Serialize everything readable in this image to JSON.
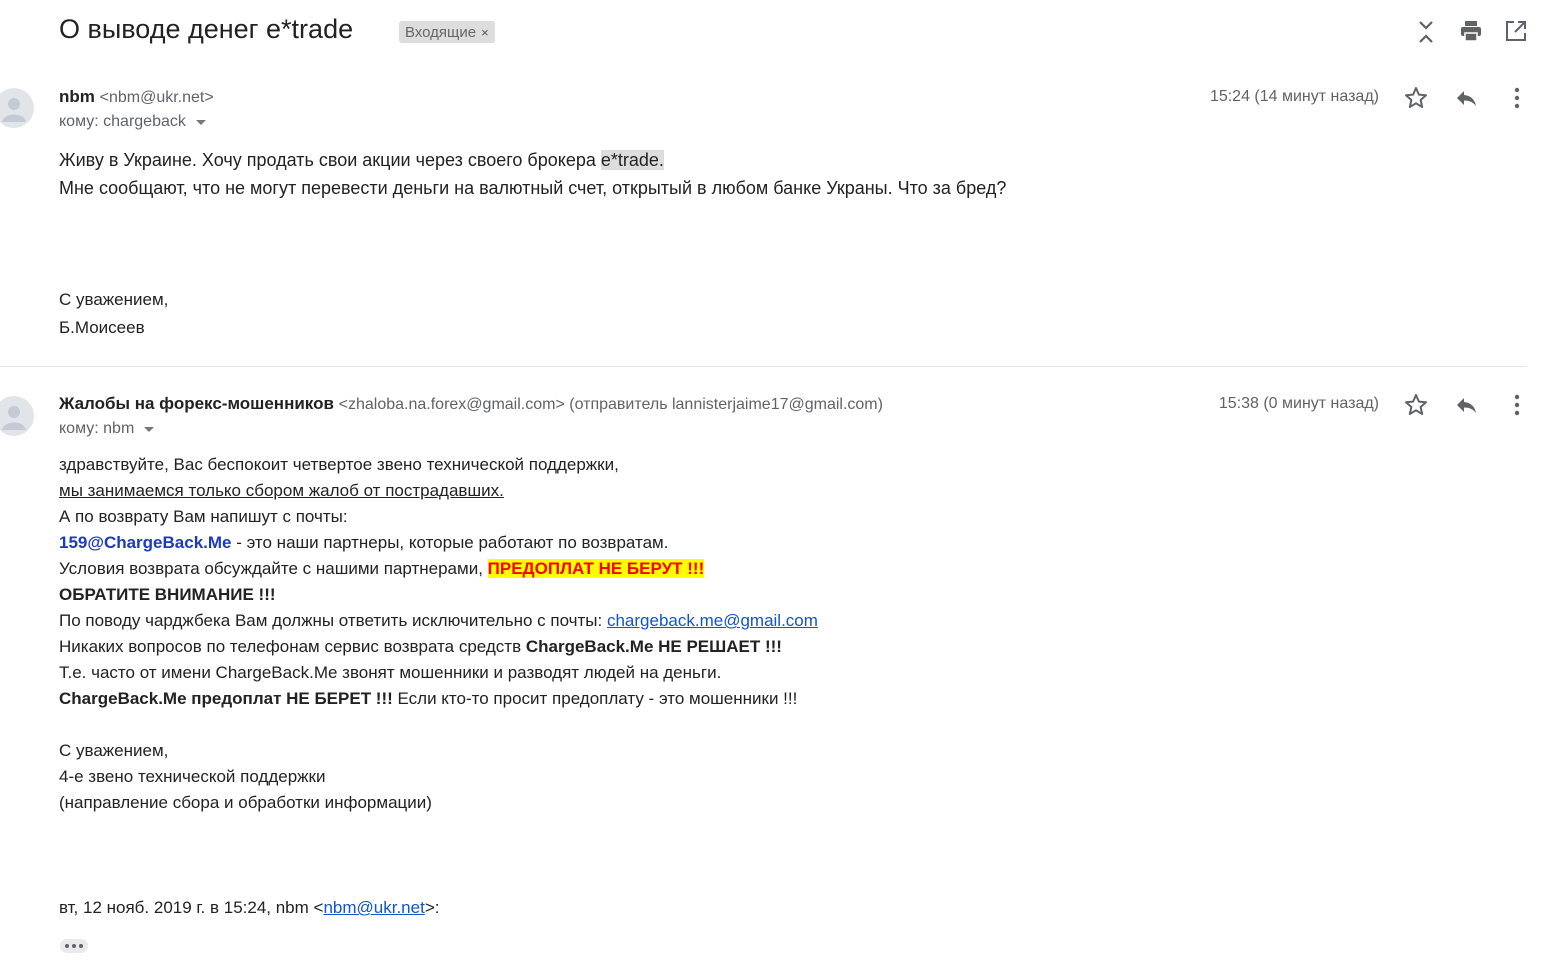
{
  "header": {
    "subject": "О выводе денег e*trade",
    "label": "Входящие",
    "label_close": "×"
  },
  "message1": {
    "sender_name": "nbm",
    "sender_addr": "<nbm@ukr.net>",
    "to_label": "кому: chargeback",
    "time": "15:24 (14 минут назад)",
    "line1_pre": "Живу в Украине. Хочу продать свои акции через своего брокера ",
    "line1_hl": "e*trade.",
    "line2": "Мне сообщают, что не могут перевести деньги на валютный счет, открытый в любом банке Украны. Что за бред?",
    "sig_line1": "С уважением,",
    "sig_line2": "Б.Моисеев"
  },
  "message2": {
    "sender_name": "Жалобы на форекс-мошенников",
    "sender_addr": "<zhaloba.na.forex@gmail.com> (отправитель lannisterjaime17@gmail.com)",
    "to_label": "кому: nbm",
    "time": "15:38 (0 минут назад)",
    "l1": "здравствуйте, Вас беспокоит четвертое звено технической поддержки,",
    "l2": "мы занимаемся только сбором жалоб от пострадавших.",
    "l3": "А по возврату Вам напишут с почты:",
    "l4_email": "159@ChargeBack.Me",
    "l4_rest": " - это наши партнеры, которые работают по возвратам.",
    "l5_pre": "Условия возврата обсуждайте с нашими партнерами, ",
    "l5_warn": "ПРЕДОПЛАТ НЕ БЕРУТ !!!",
    "l6": "ОБРАТИТЕ ВНИМАНИЕ !!!",
    "l7_pre": "По поводу чарджбека Вам должны ответить исключительно с почты: ",
    "l7_link": "chargeback.me@gmail.com",
    "l8_pre": "Никаких вопросов по телефонам сервис возврата средств ",
    "l8_bold": "ChargeBack.Me НЕ РЕШАЕТ !!!",
    "l9": "Т.е. часто от имени ChargeBack.Me звонят мошенники и разводят людей на деньги.",
    "l10_bold": "ChargeBack.Me предоплат НЕ БЕРЕТ !!!",
    "l10_rest": " Если кто-то просит предоплату - это мошенники !!!",
    "sig1": "С уважением,",
    "sig2": "4-е звено технической поддержки",
    "sig3": "(направление сбора и обработки информации)",
    "quote_pre": "вт, 12 нояб. 2019 г. в 15:24, nbm <",
    "quote_link": "nbm@ukr.net",
    "quote_post": ">:"
  },
  "icons": {
    "collapse": "collapse-all-icon",
    "print": "print-icon",
    "open_new": "open-in-new-window-icon",
    "star": "star-icon",
    "reply": "reply-icon",
    "more": "more-vert-icon",
    "avatar": "default-avatar-icon"
  }
}
